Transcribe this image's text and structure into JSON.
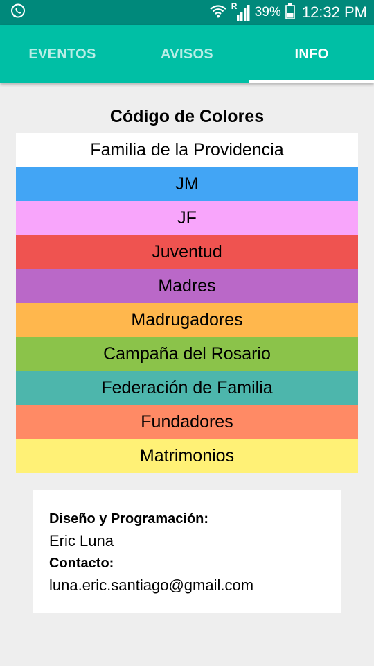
{
  "status_bar": {
    "battery": "39%",
    "time": "12:32 PM",
    "roaming": "R",
    "icons": [
      "whatsapp-icon",
      "wifi-icon",
      "signal-icon",
      "battery-icon"
    ]
  },
  "tabs": [
    {
      "label": "EVENTOS",
      "active": false
    },
    {
      "label": "AVISOS",
      "active": false
    },
    {
      "label": "INFO",
      "active": true
    }
  ],
  "colors_section": {
    "title": "Código de Colores",
    "items": [
      {
        "label": "Familia de la Providencia",
        "color": "#ffffff"
      },
      {
        "label": "JM",
        "color": "#42a5f5"
      },
      {
        "label": "JF",
        "color": "#f8a5fb"
      },
      {
        "label": "Juventud",
        "color": "#ef5350"
      },
      {
        "label": "Madres",
        "color": "#ba68c8"
      },
      {
        "label": "Madrugadores",
        "color": "#ffb74d"
      },
      {
        "label": "Campaña del Rosario",
        "color": "#8bc34a"
      },
      {
        "label": "Federación de Familia",
        "color": "#4db6ac"
      },
      {
        "label": "Fundadores",
        "color": "#ff8a65"
      },
      {
        "label": "Matrimonios",
        "color": "#fff176"
      }
    ]
  },
  "credits": {
    "design_label": "Diseño y Programación:",
    "designer": "Eric Luna",
    "contact_label": "Contacto:",
    "email": "luna.eric.santiago@gmail.com"
  },
  "theme": {
    "status_bar": "#00897b",
    "app_bar": "#00bfa5",
    "background": "#eeeeee"
  }
}
